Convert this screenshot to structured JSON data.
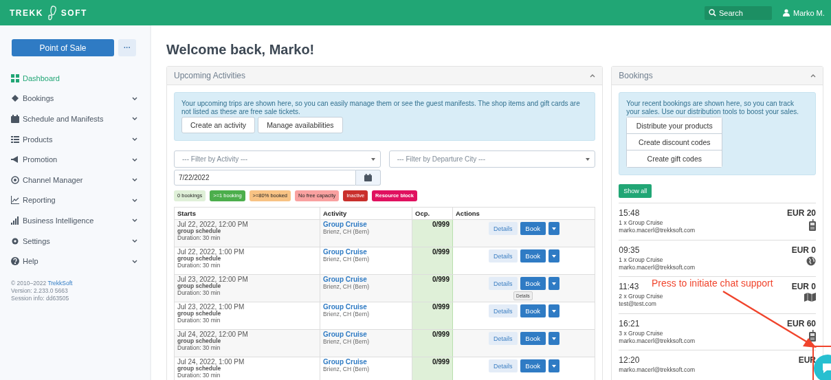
{
  "topbar": {
    "logo_left": "TREKK",
    "logo_right": "SOFT",
    "search": {
      "placeholder": "Search"
    },
    "user": "Marko M."
  },
  "sidebar": {
    "primary_button": "Point of Sale",
    "more_button": "···",
    "items": [
      {
        "label": "Dashboard",
        "selected": true,
        "expandable": false
      },
      {
        "label": "Bookings",
        "selected": false,
        "expandable": true
      },
      {
        "label": "Schedule and Manifests",
        "selected": false,
        "expandable": true
      },
      {
        "label": "Products",
        "selected": false,
        "expandable": true
      },
      {
        "label": "Promotion",
        "selected": false,
        "expandable": true
      },
      {
        "label": "Channel Manager",
        "selected": false,
        "expandable": true
      },
      {
        "label": "Reporting",
        "selected": false,
        "expandable": true
      },
      {
        "label": "Business Intelligence",
        "selected": false,
        "expandable": true
      },
      {
        "label": "Settings",
        "selected": false,
        "expandable": true
      },
      {
        "label": "Help",
        "selected": false,
        "expandable": true
      }
    ],
    "footer": {
      "copyright": "© 2010–2022",
      "company_link": "TrekkSoft",
      "version": "Version: 2.233.0 5663",
      "session": "Session info: dd63505"
    }
  },
  "heading": "Welcome back, Marko!",
  "upcoming": {
    "title": "Upcoming Activities",
    "info": "Your upcoming trips are shown here, so you can easily manage them or see the guest manifests. The shop items and gift cards are not listed as these are free sale tickets.",
    "buttons": [
      "Create an activity",
      "Manage availabilities"
    ],
    "filter_activity": {
      "placeholder": "--- Filter by Activity ---"
    },
    "filter_city": {
      "placeholder": "--- Filter by Departure City ---"
    },
    "date": {
      "value": "7/22/2022"
    },
    "legend": [
      {
        "label": "0 bookings",
        "color": "#dff0d8"
      },
      {
        "label": ">=1 booking",
        "color": "#4cae4c"
      },
      {
        "label": ">=80% booked",
        "color": "#f8c384"
      },
      {
        "label": "No free capacity",
        "color": "#f9a1a0"
      },
      {
        "label": "Inactive",
        "color": "#c9302c"
      },
      {
        "label": "Resource block",
        "color": "#e0115f"
      }
    ],
    "table": {
      "columns": [
        "Starts",
        "Activity",
        "Ocp.",
        "Actions"
      ],
      "rows": [
        {
          "starts": "Jul 22, 2022, 12:00 PM",
          "schedule": "group schedule",
          "duration": "Duration: 30 min",
          "activity": "Group Cruise",
          "location": "Brienz, CH (Bern)",
          "occupancy": "0/999",
          "details": "Details",
          "book": "Book"
        },
        {
          "starts": "Jul 22, 2022, 1:00 PM",
          "schedule": "group schedule",
          "duration": "Duration: 30 min",
          "activity": "Group Cruise",
          "location": "Brienz, CH (Bern)",
          "occupancy": "0/999",
          "details": "Details",
          "book": "Book"
        },
        {
          "starts": "Jul 23, 2022, 12:00 PM",
          "schedule": "group schedule",
          "duration": "Duration: 30 min",
          "activity": "Group Cruise",
          "location": "Brienz, CH (Bern)",
          "occupancy": "0/999",
          "details": "Details",
          "book": "Book",
          "tooltip": "Details"
        },
        {
          "starts": "Jul 23, 2022, 1:00 PM",
          "schedule": "group schedule",
          "duration": "Duration: 30 min",
          "activity": "Group Cruise",
          "location": "Brienz, CH (Bern)",
          "occupancy": "0/999",
          "details": "Details",
          "book": "Book"
        },
        {
          "starts": "Jul 24, 2022, 12:00 PM",
          "schedule": "group schedule",
          "duration": "Duration: 30 min",
          "activity": "Group Cruise",
          "location": "Brienz, CH (Bern)",
          "occupancy": "0/999",
          "details": "Details",
          "book": "Book"
        },
        {
          "starts": "Jul 24, 2022, 1:00 PM",
          "schedule": "group schedule",
          "duration": "Duration: 30 min",
          "activity": "Group Cruise",
          "location": "Brienz, CH (Bern)",
          "occupancy": "0/999",
          "details": "Details",
          "book": "Book"
        }
      ]
    }
  },
  "bookings": {
    "title": "Bookings",
    "info": "Your recent bookings are shown here, so you can track your sales. Use our distribution tools to boost your sales.",
    "buttons": [
      "Distribute your products",
      "Create discount codes",
      "Create gift codes"
    ],
    "show_all": "Show all",
    "items": [
      {
        "time": "15:48",
        "amount": "EUR 20",
        "product": "1 x Group Cruise",
        "email": "marko.macerl@trekksoft.com",
        "kind": "phone"
      },
      {
        "time": "09:35",
        "amount": "EUR 0",
        "product": "1 x Group Cruise",
        "email": "marko.macerl@trekksoft.com",
        "kind": "web"
      },
      {
        "time": "11:43",
        "amount": "EUR 0",
        "product": "2 x Group Cruise",
        "email": "test@test.com",
        "kind": "map"
      },
      {
        "time": "16:21",
        "amount": "EUR 60",
        "product": "3 x Group Cruise",
        "email": "marko.macerl@trekksoft.com",
        "kind": "phone"
      },
      {
        "time": "12:20",
        "amount": "EUR",
        "email": "marko.macerl@trekksoft.com"
      }
    ]
  },
  "annotation": {
    "text": "Press to initiate chat support"
  }
}
